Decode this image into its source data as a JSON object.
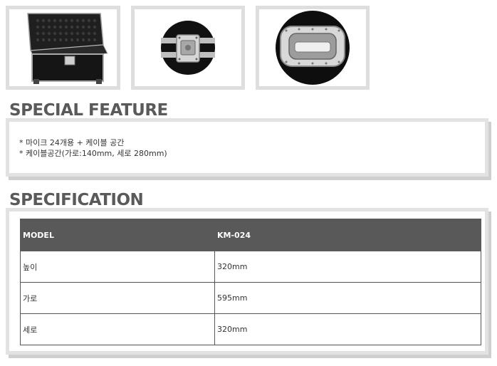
{
  "special_feature": {
    "title": "SPECIAL FEATURE",
    "lines": [
      "* 마이크 24개용 + 케이블 공간",
      "* 케이블공간(가로:140mm, 세로 280mm)"
    ]
  },
  "specification": {
    "title": "SPECIFICATION",
    "headers": [
      "MODEL",
      "KM-024"
    ],
    "rows": [
      [
        "높이",
        "320mm"
      ],
      [
        "가로",
        "595mm"
      ],
      [
        "세로",
        "320mm"
      ]
    ]
  },
  "colors": {
    "heading": "#5a5a5a",
    "table_header": "#595959",
    "frame": "#dedede"
  }
}
